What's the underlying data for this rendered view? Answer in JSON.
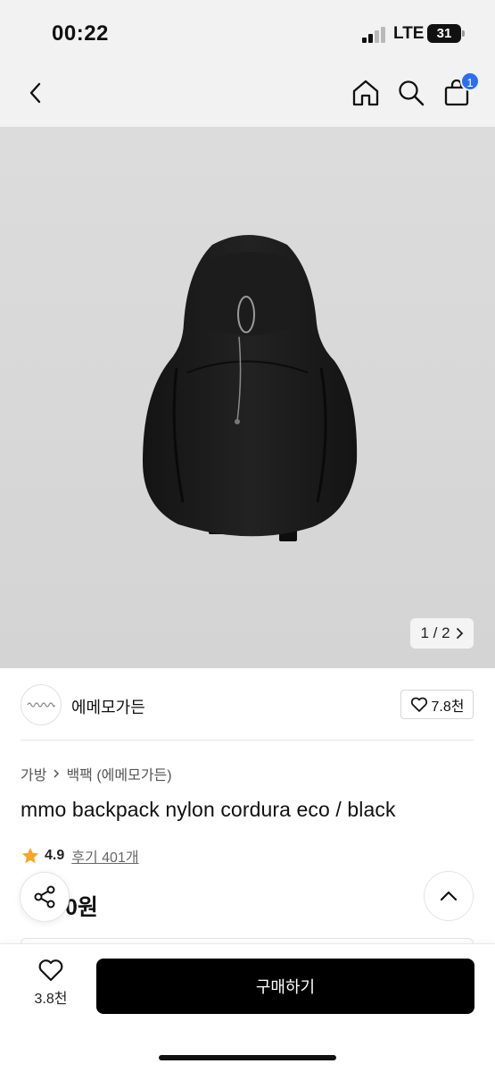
{
  "status_bar": {
    "time": "00:22",
    "network": "LTE",
    "battery": "31"
  },
  "nav": {
    "cart_count": "1"
  },
  "product_image": {
    "counter_text": "1 / 2"
  },
  "seller": {
    "name": "에메모가든",
    "likes": "7.8천"
  },
  "breadcrumb": {
    "category": "가방",
    "subcategory": "백팩 (에메모가든)"
  },
  "product": {
    "title": "mmo backpack nylon cordura eco / black",
    "rating": "4.9",
    "reviews_label": "후기 401개",
    "price_visible": "0원"
  },
  "bottom_bar": {
    "wish_count": "3.8천",
    "buy_label": "구매하기"
  },
  "colors": {
    "accent_blue": "#2b6ef5",
    "rating_star": "#f5a623",
    "buy_button": "#000000"
  }
}
